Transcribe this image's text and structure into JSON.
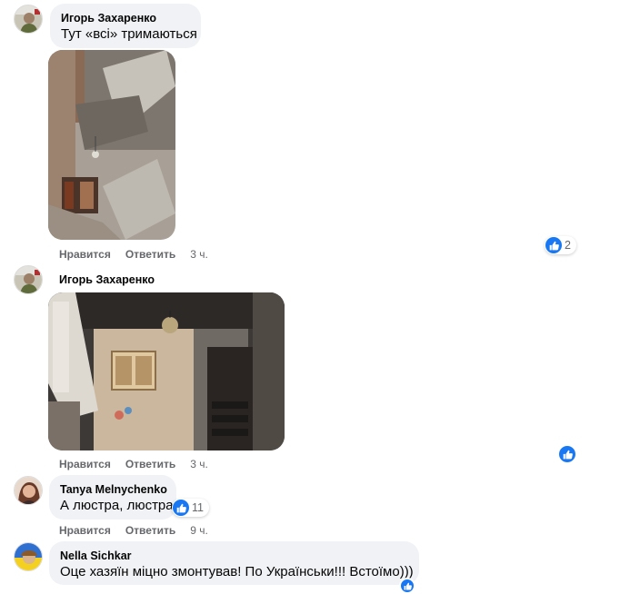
{
  "comments": [
    {
      "author": "Игорь Захаренко",
      "text": "Тут «всі» тримаються",
      "actions": {
        "like": "Нравится",
        "reply": "Ответить",
        "time": "3 ч."
      },
      "reaction_count": "2"
    },
    {
      "author": "Игорь Захаренко",
      "actions": {
        "like": "Нравится",
        "reply": "Ответить",
        "time": "3 ч."
      }
    },
    {
      "author": "Tanya Melnychenko",
      "text": "А люстра, люстра",
      "actions": {
        "like": "Нравится",
        "reply": "Ответить",
        "time": "9 ч."
      },
      "reaction_count": "11"
    },
    {
      "author": "Nella Sichkar",
      "text": "Оце хазяїн міцно змонтував! По Українськи!!! Встоїмо)))"
    }
  ],
  "colors": {
    "accent": "#1877f2",
    "bubble": "#f0f2f5",
    "meta": "#65676b"
  },
  "icons": [
    "avatar",
    "like-icon"
  ]
}
